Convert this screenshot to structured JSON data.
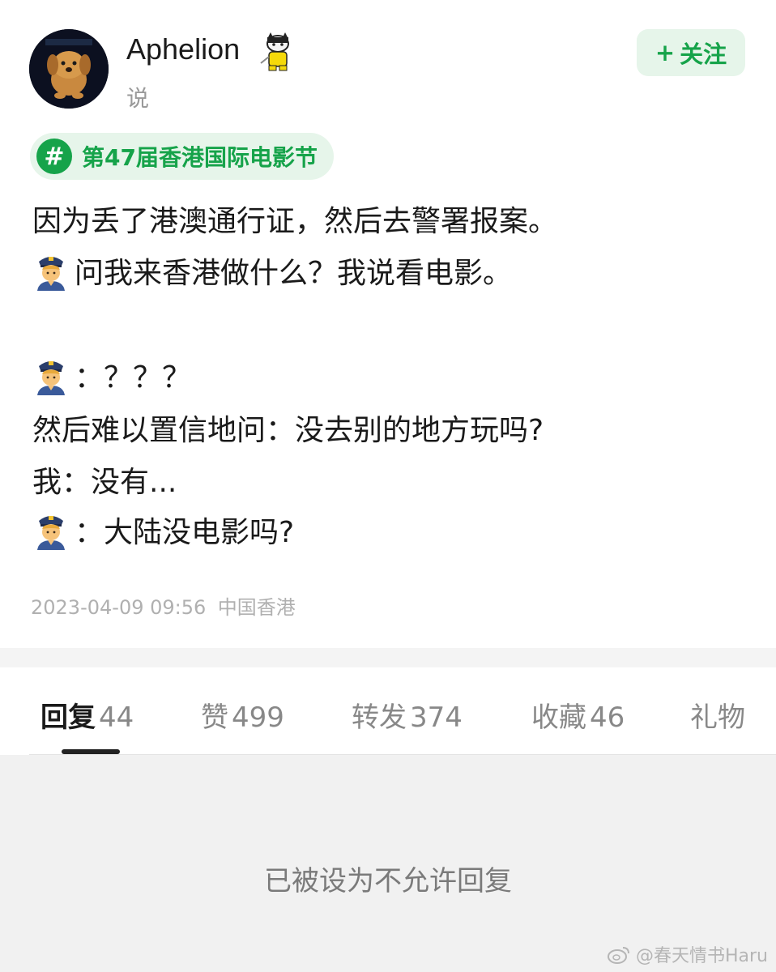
{
  "post": {
    "author": "Aphelion",
    "subtitle": "说",
    "follow_label": "关注",
    "follow_plus": "+",
    "topic_icon": "#",
    "topic": "第47届香港国际电影节",
    "lines": [
      "因为丢了港澳通行证，然后去警署报案。",
      "问我来香港做什么？我说看电影。",
      "：？？？",
      "然后难以置信地问：没去别的地方玩吗?",
      "我：没有...",
      "：大陆没电影吗?"
    ],
    "timestamp": "2023-04-09 09:56",
    "location": "中国香港"
  },
  "tabs": [
    {
      "label": "回复",
      "count": "44"
    },
    {
      "label": "赞",
      "count": "499"
    },
    {
      "label": "转发",
      "count": "374"
    },
    {
      "label": "收藏",
      "count": "46"
    },
    {
      "label": "礼物",
      "count": ""
    }
  ],
  "replies": {
    "message": "已被设为不允许回复"
  },
  "watermark": "@春天情书Haru",
  "colors": {
    "accent_green": "#16a34a",
    "tag_bg": "#e6f5ea",
    "avatar_bg": "#0a0d16"
  },
  "icons": {
    "avatar": "dog-avatar",
    "badge": "cat-badge-icon",
    "emoji": "police-officer-emoji",
    "watermark": "weibo-icon"
  }
}
